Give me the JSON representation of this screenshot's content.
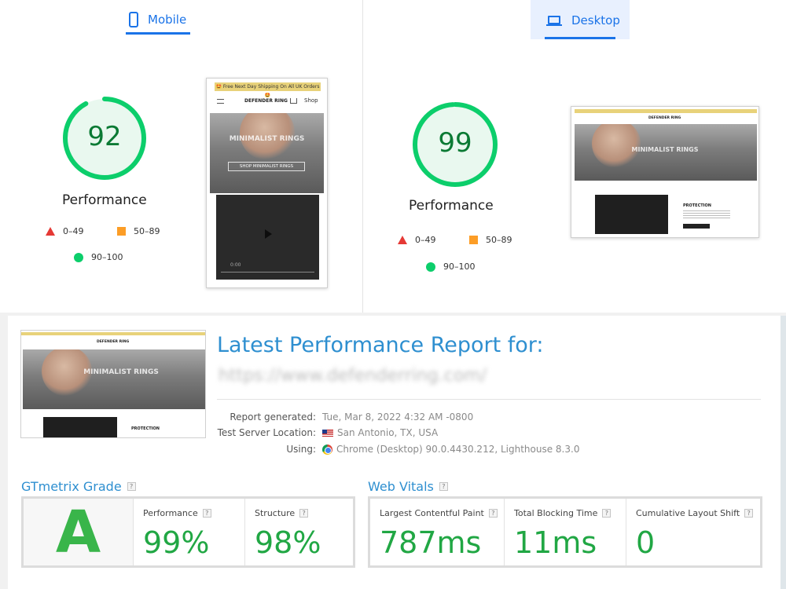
{
  "mobile": {
    "tab_label": "Mobile",
    "score": "92",
    "score_fraction": 0.92,
    "label": "Performance",
    "legend": {
      "fail": "0–49",
      "average": "50–89",
      "pass": "90–100"
    },
    "screenshot": {
      "banner": "🤩 Free Next Day Shipping On All UK Orders 🤩",
      "brand": "DEFENDER RING",
      "shop": "Shop",
      "hero_title": "MINIMALIST RINGS",
      "hero_button": "SHOP MINIMALIST RINGS",
      "video_time": "0:00"
    }
  },
  "desktop": {
    "tab_label": "Desktop",
    "score": "99",
    "score_fraction": 0.99,
    "label": "Performance",
    "legend": {
      "fail": "0–49",
      "average": "50–89",
      "pass": "90–100"
    },
    "screenshot": {
      "brand": "DEFENDER RING",
      "hero_title": "MINIMALIST RINGS",
      "protection": "PROTECTION"
    }
  },
  "gtmetrix": {
    "title": "Latest Performance Report for:",
    "url": "https://www.defenderring.com/",
    "thumb": {
      "brand": "DEFENDER RING",
      "hero_title": "MINIMALIST RINGS",
      "protection": "PROTECTION"
    },
    "report_generated_label": "Report generated:",
    "report_generated_value": "Tue, Mar 8, 2022 4:32 AM -0800",
    "server_label": "Test Server Location:",
    "server_value": "San Antonio, TX, USA",
    "using_label": "Using:",
    "using_value": "Chrome (Desktop) 90.0.4430.212, Lighthouse 8.3.0",
    "grade_title": "GTmetrix Grade",
    "grade": "A",
    "performance_label": "Performance",
    "performance_value": "99%",
    "structure_label": "Structure",
    "structure_value": "98%",
    "vitals_title": "Web Vitals",
    "lcp_label": "Largest Contentful Paint",
    "lcp_value": "787ms",
    "tbt_label": "Total Blocking Time",
    "tbt_value": "11ms",
    "cls_label": "Cumulative Layout Shift",
    "cls_value": "0",
    "help": "?"
  },
  "colors": {
    "accent_blue": "#1a73e8",
    "gauge_green": "#0cce6b",
    "gauge_text": "#0b7a34",
    "fail_red": "#e53935",
    "average_orange": "#fb8c00",
    "gt_blue": "#2e8fd0",
    "metric_green": "#21a744"
  }
}
